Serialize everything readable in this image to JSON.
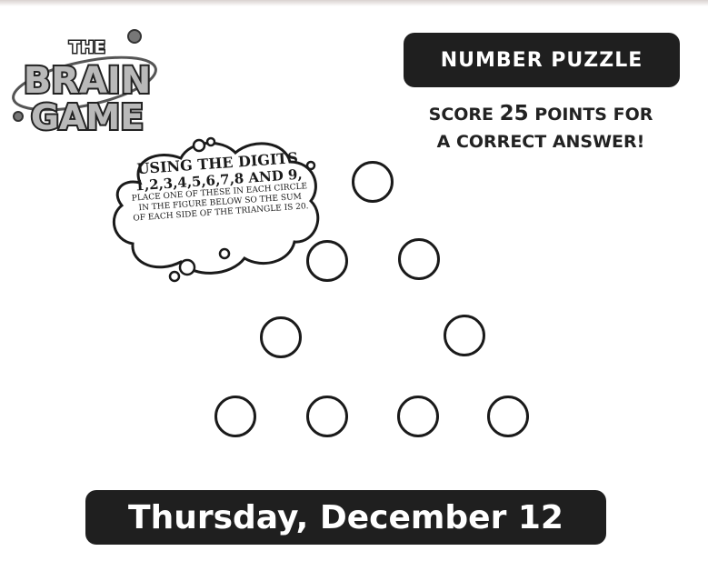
{
  "logo": {
    "word1": "THE",
    "word2": "BRAIN",
    "word3": "GAME"
  },
  "header": {
    "title": "NUMBER PUZZLE"
  },
  "score": {
    "prefix": "SCORE ",
    "points": "25",
    "suffix": " POINTS FOR",
    "line2": "A CORRECT ANSWER!"
  },
  "instructions": {
    "line1": "USING THE DIGITS",
    "line2": "1,2,3,4,5,6,7,8 AND 9,",
    "line3a": "PLACE ONE OF THESE IN EACH CIRCLE",
    "line3b": "IN THE FIGURE BELOW SO THE SUM",
    "line3c": "OF EACH SIDE OF THE TRIANGLE IS 20."
  },
  "puzzle": {
    "circle_count": 9
  },
  "footer": {
    "date": "Thursday, December 12"
  },
  "colors": {
    "banner": "#1f1f1f",
    "banner_text": "#ffffff",
    "ink": "#1a1a1a"
  }
}
